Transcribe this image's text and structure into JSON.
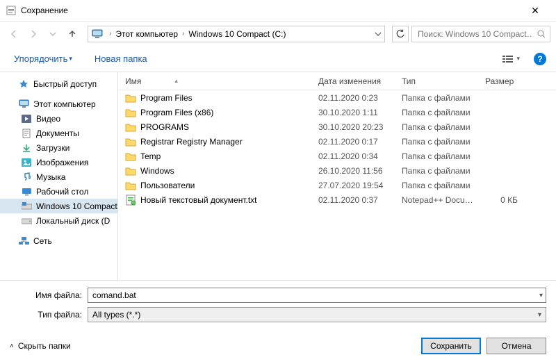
{
  "window": {
    "title": "Сохранение"
  },
  "breadcrumb": {
    "items": [
      "Этот компьютер",
      "Windows 10 Compact  (C:)"
    ]
  },
  "search": {
    "placeholder": "Поиск: Windows 10 Compact…"
  },
  "toolbar": {
    "organize": "Упорядочить",
    "newfolder": "Новая папка"
  },
  "columns": {
    "name": "Имя",
    "date": "Дата изменения",
    "type": "Тип",
    "size": "Размер"
  },
  "sidebar": {
    "quick": "Быстрый доступ",
    "thispc": "Этот компьютер",
    "video": "Видео",
    "documents": "Документы",
    "downloads": "Загрузки",
    "pictures": "Изображения",
    "music": "Музыка",
    "desktop": "Рабочий стол",
    "drive_c": "Windows 10 Compact",
    "drive_d": "Локальный диск (D",
    "network": "Сеть"
  },
  "files": [
    {
      "icon": "folder",
      "name": "Program Files",
      "date": "02.11.2020 0:23",
      "type": "Папка с файлами",
      "size": ""
    },
    {
      "icon": "folder",
      "name": "Program Files (x86)",
      "date": "30.10.2020 1:11",
      "type": "Папка с файлами",
      "size": ""
    },
    {
      "icon": "folder",
      "name": "PROGRAMS",
      "date": "30.10.2020 20:23",
      "type": "Папка с файлами",
      "size": ""
    },
    {
      "icon": "folder",
      "name": "Registrar Registry Manager",
      "date": "02.11.2020 0:17",
      "type": "Папка с файлами",
      "size": ""
    },
    {
      "icon": "folder",
      "name": "Temp",
      "date": "02.11.2020 0:34",
      "type": "Папка с файлами",
      "size": ""
    },
    {
      "icon": "folder",
      "name": "Windows",
      "date": "26.10.2020 11:56",
      "type": "Папка с файлами",
      "size": ""
    },
    {
      "icon": "folder",
      "name": "Пользователи",
      "date": "27.07.2020 19:54",
      "type": "Папка с файлами",
      "size": ""
    },
    {
      "icon": "txt",
      "name": "Новый текстовый документ.txt",
      "date": "02.11.2020 0:37",
      "type": "Notepad++ Docu…",
      "size": "0 КБ"
    }
  ],
  "form": {
    "filename_label": "Имя файла:",
    "filename_value": "comand.bat",
    "filetype_label": "Тип файла:",
    "filetype_value": "All types (*.*)"
  },
  "footer": {
    "hide": "Скрыть папки",
    "save": "Сохранить",
    "cancel": "Отмена"
  }
}
